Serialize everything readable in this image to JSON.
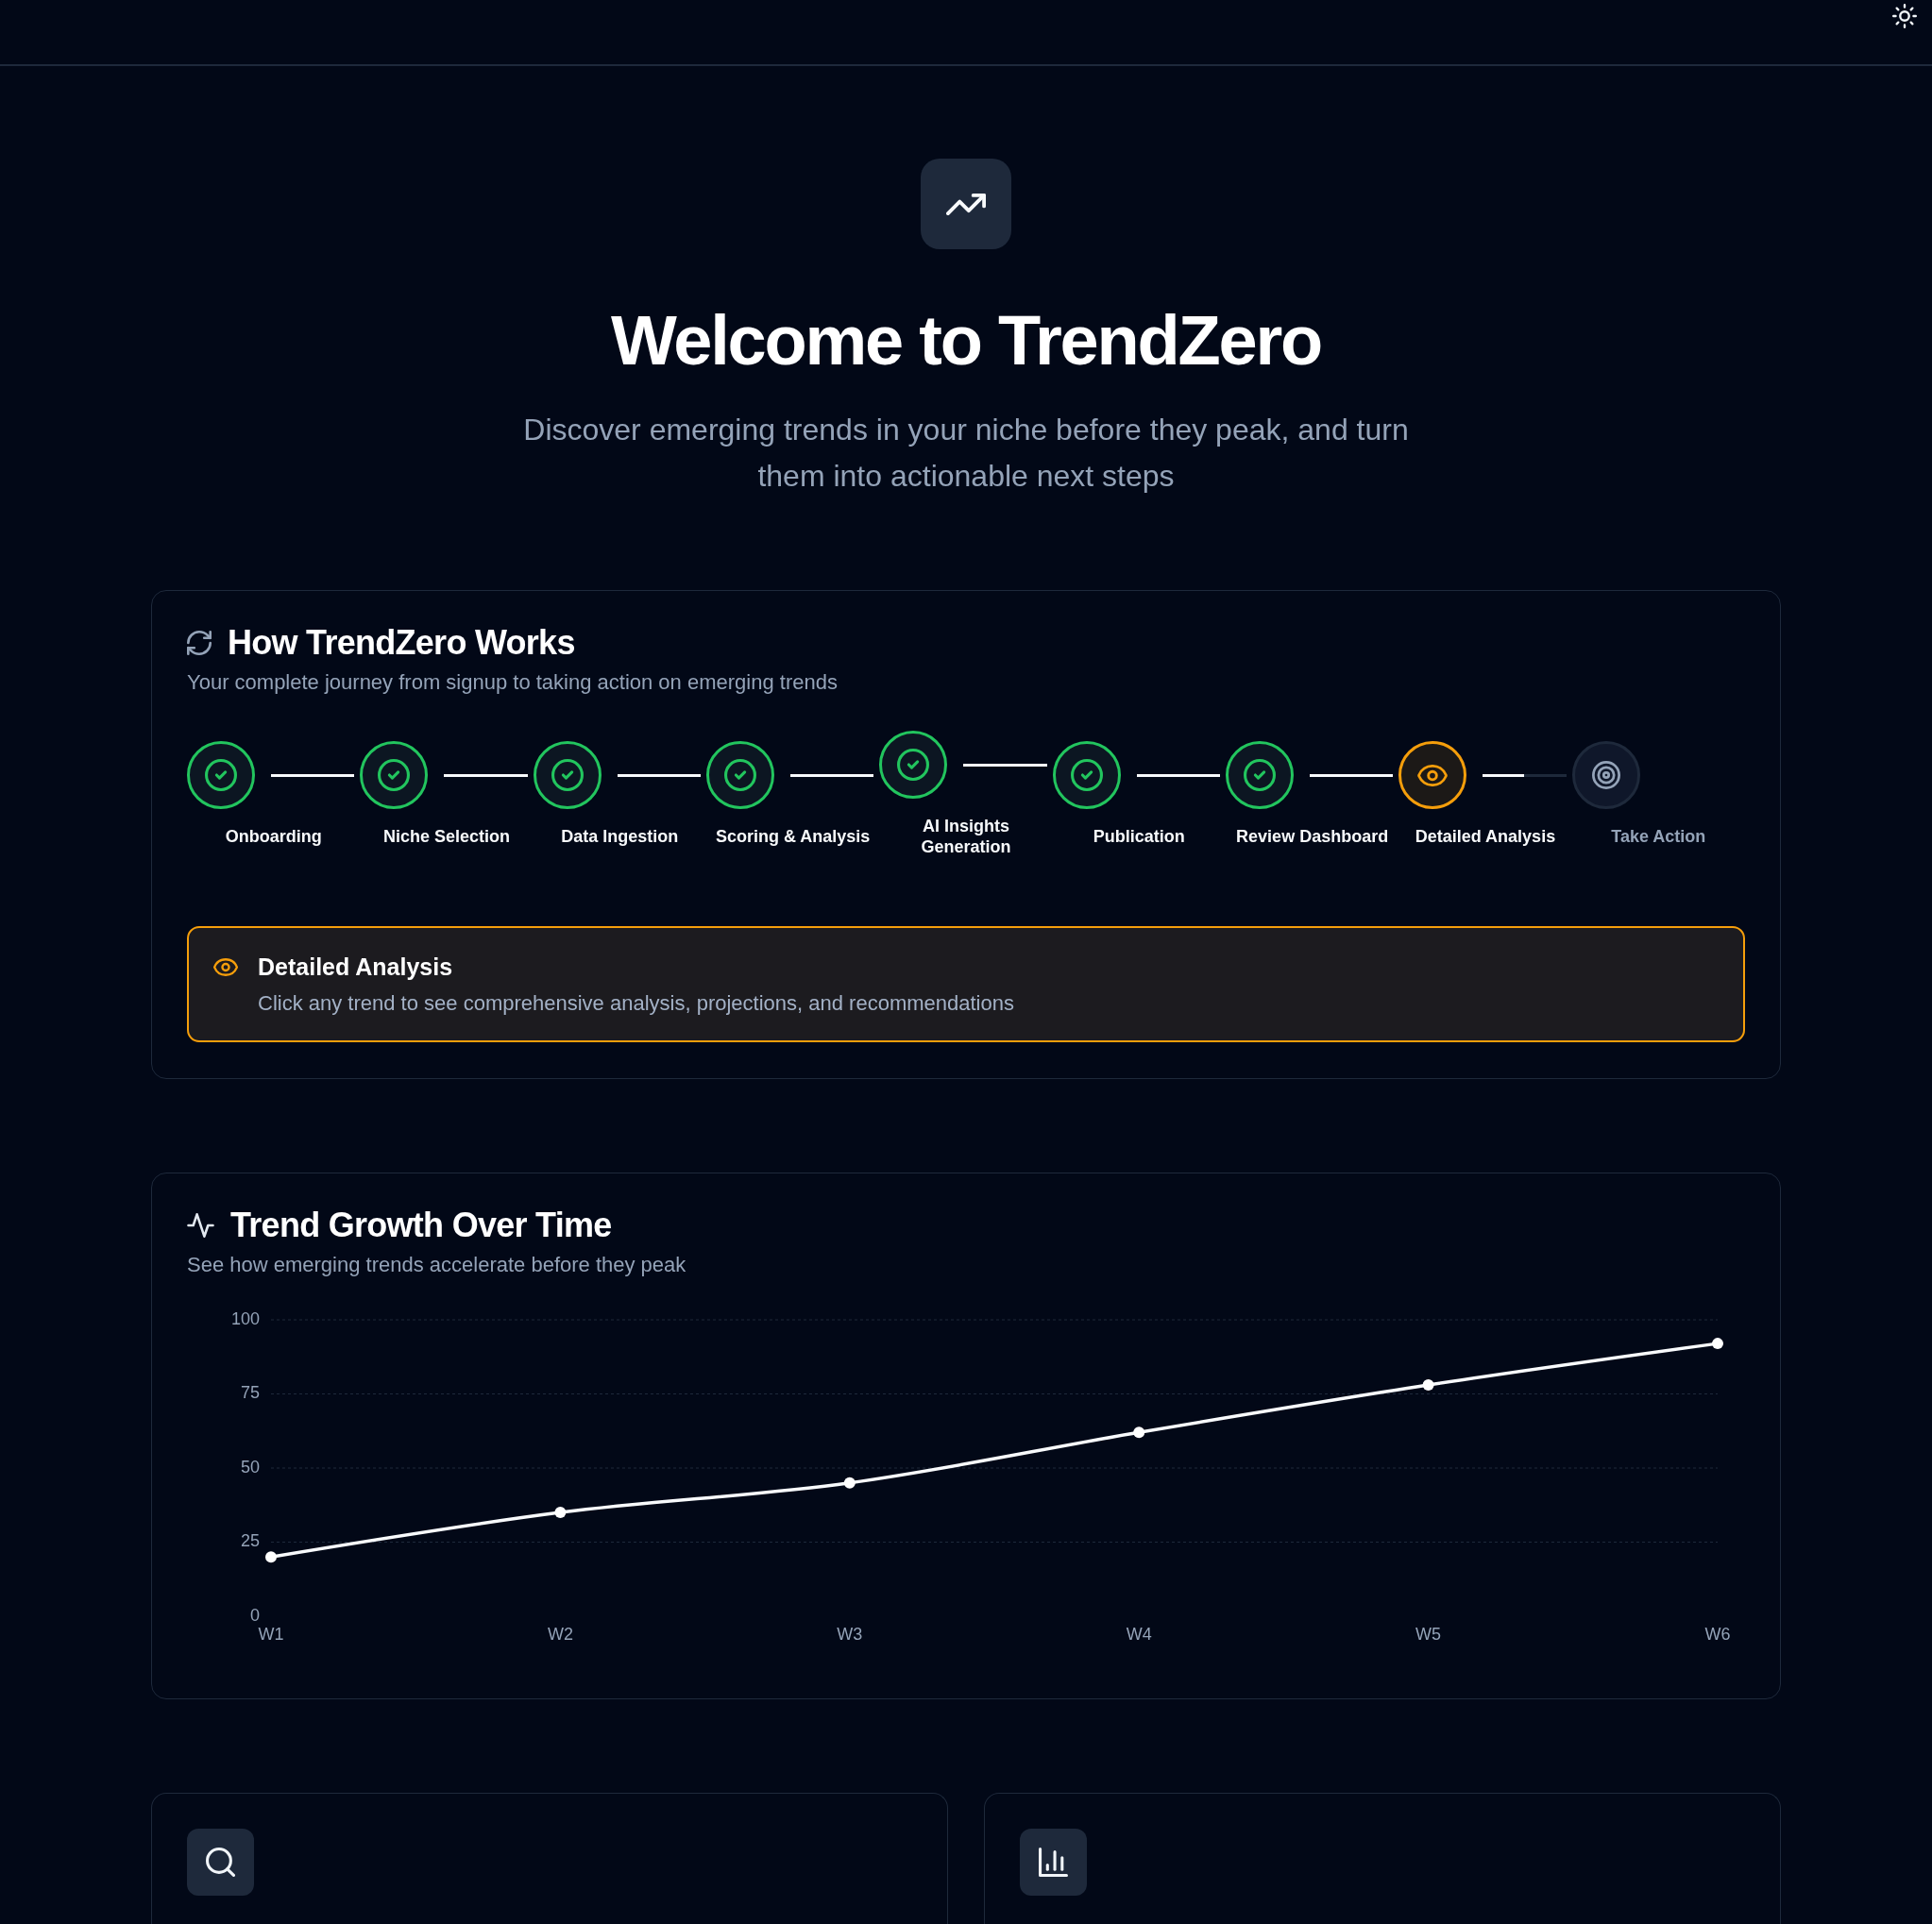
{
  "hero": {
    "title": "Welcome to TrendZero",
    "subtitle": "Discover emerging trends in your niche before they peak, and turn them into actionable next steps"
  },
  "how_it_works": {
    "title": "How TrendZero Works",
    "subtitle": "Your complete journey from signup to taking action on emerging trends",
    "steps": [
      {
        "label": "Onboarding",
        "completed": true,
        "selected": false,
        "level": 1
      },
      {
        "label": "Niche Selection",
        "completed": true,
        "selected": false,
        "level": 1
      },
      {
        "label": "Data Ingestion",
        "completed": true,
        "selected": false,
        "level": 1
      },
      {
        "label": "Scoring & Analysis",
        "completed": true,
        "selected": false,
        "level": 1
      },
      {
        "label": "AI Insights Generation",
        "completed": true,
        "selected": false,
        "level": 1
      },
      {
        "label": "Publication",
        "completed": true,
        "selected": false,
        "level": 1
      },
      {
        "label": "Review Dashboard",
        "completed": true,
        "selected": false,
        "level": 1
      },
      {
        "label": "Detailed Analysis",
        "completed": false,
        "selected": true,
        "level": 0.5
      },
      {
        "label": "Take Action",
        "completed": false,
        "selected": false
      }
    ],
    "detail": {
      "title": "Detailed Analysis",
      "description": "Click any trend to see comprehensive analysis, projections, and recommendations"
    }
  },
  "trend_growth": {
    "title": "Trend Growth Over Time",
    "subtitle": "See how emerging trends accelerate before they peak",
    "chart_data": {
      "type": "line",
      "categories": [
        "W1",
        "W2",
        "W3",
        "W4",
        "W5",
        "W6"
      ],
      "values": [
        20,
        35,
        45,
        62,
        78,
        92
      ],
      "ylim": [
        0,
        100
      ],
      "yticks": [
        0,
        25,
        50,
        75,
        100
      ],
      "grid": true,
      "marker": true
    }
  },
  "feature_cards": [
    {
      "kind": "search"
    },
    {
      "kind": "chart"
    }
  ]
}
